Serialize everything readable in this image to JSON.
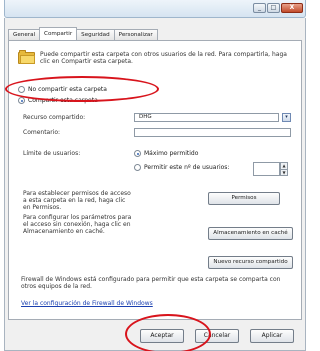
{
  "window": {
    "controls": {
      "minimize": "_",
      "maximize": "□",
      "close": "X"
    }
  },
  "tabs": [
    {
      "label": "General",
      "active": false
    },
    {
      "label": "Compartir",
      "active": true
    },
    {
      "label": "Seguridad",
      "active": false
    },
    {
      "label": "Personalizar",
      "active": false
    }
  ],
  "header": {
    "folder_icon": "folder-icon",
    "description": "Puede compartir esta carpeta con otros usuarios de la red. Para compartirla, haga clic en Compartir esta carpeta."
  },
  "share_options": {
    "no_share": {
      "label": "No compartir esta carpeta",
      "selected": false
    },
    "share": {
      "label": "Compartir esta carpeta",
      "selected": true
    }
  },
  "share_name": {
    "label": "Recurso compartido:",
    "value": "DHG"
  },
  "comment": {
    "label": "Comentario:",
    "value": ""
  },
  "user_limit": {
    "label": "Límite de usuarios:",
    "max_allowed": {
      "label": "Máximo permitido",
      "selected": true
    },
    "allow_n": {
      "label": "Permitir este nº de usuarios:",
      "selected": false,
      "value": ""
    }
  },
  "permissions": {
    "text": "Para establecer permisos de acceso a esta carpeta en la red, haga clic en Permisos.",
    "button": "Permisos"
  },
  "caching": {
    "text": "Para configurar los parámetros para el acceso sin conexión, haga clic en Almacenamiento en caché.",
    "button": "Almacenamiento en caché"
  },
  "new_share_button": "Nuevo recurso compartido",
  "firewall": {
    "text": "Firewall de Windows está configurado para permitir que esta carpeta se comparta con otros equipos de la red.",
    "link": "Ver la configuración de Firewall de Windows"
  },
  "footer": {
    "ok": "Aceptar",
    "cancel": "Cancelar",
    "apply": "Aplicar"
  },
  "colors": {
    "annotation": "#d8141c",
    "link": "#1a3fb0",
    "accent": "#3768b7"
  }
}
